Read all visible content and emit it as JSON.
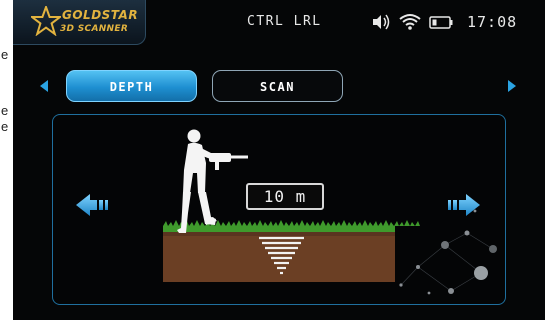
{
  "side_text": [
    "e",
    "e",
    "e"
  ],
  "header": {
    "logo_line1": "GOLDSTAR",
    "logo_line2": "3D SCANNER",
    "mode": "CTRL LRL",
    "time": "17:08"
  },
  "icons": {
    "speaker": "speaker-icon",
    "wifi": "wifi-icon",
    "battery": "battery-icon",
    "tab_prev": "triangle-left-icon",
    "tab_next": "triangle-right-icon",
    "nav_prev": "arrow-left-icon",
    "nav_next": "arrow-right-icon"
  },
  "tabs": [
    {
      "label": "DEPTH",
      "active": true
    },
    {
      "label": "SCAN",
      "active": false
    }
  ],
  "depth": {
    "value": "10",
    "unit": "m",
    "display": "10 m"
  },
  "colors": {
    "accent": "#2aa3e3",
    "logo_gold": "#e2b33f",
    "grass": "#3f9a2c",
    "soil": "#6b3f24",
    "background": "#050607"
  }
}
